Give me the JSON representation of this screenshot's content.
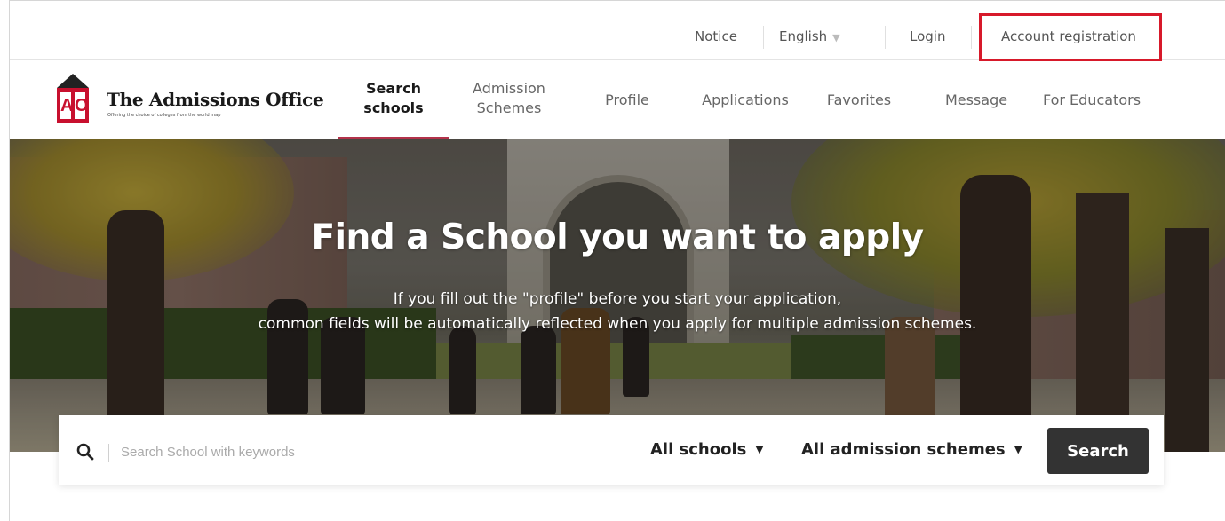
{
  "util_bar": {
    "notice": "Notice",
    "language": "English",
    "login": "Login",
    "account_registration": "Account registration"
  },
  "brand": {
    "logo_letters": [
      "A",
      "O"
    ],
    "name": "The Admissions Office",
    "tagline": "Offering the choice of colleges from the world map"
  },
  "nav": {
    "items": [
      {
        "line1": "Search",
        "line2": "schools"
      },
      {
        "line1": "Admission",
        "line2": "Schemes"
      },
      {
        "label": "Profile"
      },
      {
        "label": "Applications"
      },
      {
        "label": "Favorites"
      },
      {
        "label": "Message"
      },
      {
        "label": "For Educators"
      }
    ]
  },
  "hero": {
    "title": "Find a School you want to apply",
    "subtitle_line1": "If you fill out the \"profile\" before you start your application,",
    "subtitle_line2": "common fields will be automatically reflected when you apply for multiple admission schemes."
  },
  "search": {
    "placeholder": "Search School with keywords",
    "value": "",
    "schools_dropdown": "All schools",
    "schemes_dropdown": "All admission schemes",
    "button": "Search"
  },
  "colors": {
    "highlight_box": "#d7192a",
    "nav_active_underline": "#b3324a",
    "search_button": "#333333",
    "logo_red": "#c8102e"
  },
  "icons": [
    "search-icon",
    "chevron-down-icon",
    "logo-icon"
  ]
}
